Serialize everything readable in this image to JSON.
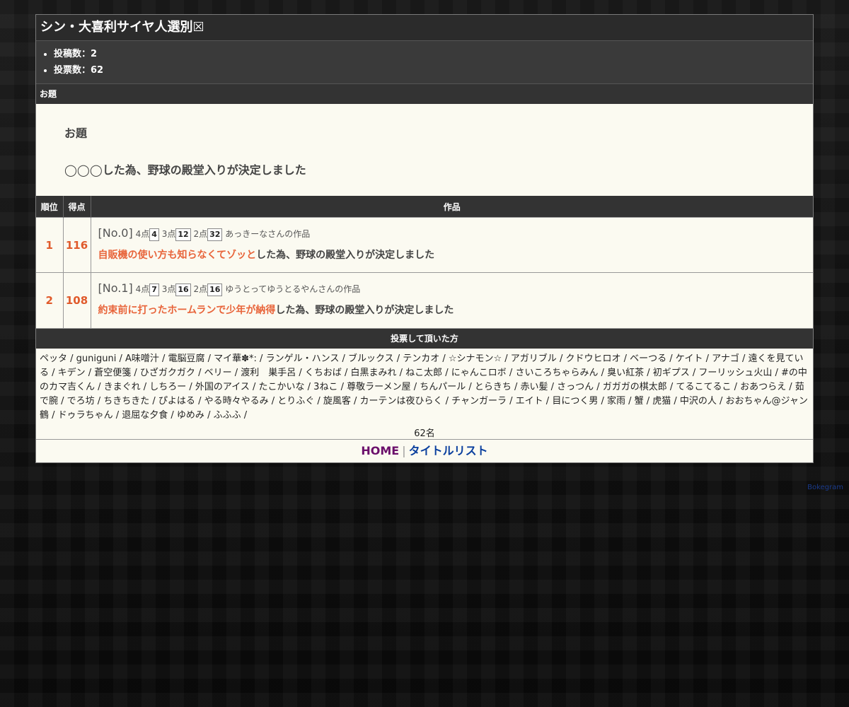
{
  "page": {
    "title": "シン・大喜利サイヤ人選別☒",
    "stats": [
      {
        "label": "投稿数：",
        "value": "2"
      },
      {
        "label": "投票数：",
        "value": "62"
      }
    ],
    "theme_section_head": "お題",
    "theme_label": "お題",
    "theme_text": "◯◯◯した為、野球の殿堂入りが決定しました"
  },
  "results": {
    "headers": {
      "rank": "順位",
      "score": "得点",
      "work": "作品"
    },
    "rows": [
      {
        "rank": "1",
        "score": "116",
        "no": "[No.0]",
        "p4_label": "4点",
        "p4": "4",
        "p3_label": "3点",
        "p3": "12",
        "p2_label": "2点",
        "p2": "32",
        "author": "あっきーなさんの作品",
        "highlight": "自販機の使い方も知らなくてゾッと",
        "suffix": "した為、野球の殿堂入りが決定しました"
      },
      {
        "rank": "2",
        "score": "108",
        "no": "[No.1]",
        "p4_label": "4点",
        "p4": "7",
        "p3_label": "3点",
        "p3": "16",
        "p2_label": "2点",
        "p2": "16",
        "author": "ゆうとってゆうとるやんさんの作品",
        "highlight": "約束前に打ったホームランで少年が納得",
        "suffix": "した為、野球の殿堂入りが決定しました"
      }
    ]
  },
  "voters": {
    "head": "投票して頂いた方",
    "list": "ペッタ / guniguni / A味噌汁 / 電脳豆腐 / マイ華✽*: / ランゲル・ハンス / ブルックス / テンカオ / ☆シナモン☆ / アガリブル / クドウヒロオ / ベーつる / ケイト / アナゴ / 遠くを見ている / キデン / 蒼空便箋 / ひざガクガク / ベリー / 渡利　巣手呂 / くちおば / 白黒まみれ / ねこ太郎 / にゃんこロボ / さいころちゃらみん / 臭い紅茶 / 初ギプス / フーリッシュ火山 / #の中のカマ吉くん / きまぐれ / しちろー / 外国のアイス / たこかいな / 3ねこ / 尊敬ラーメン屋 / ちんパール / とらきち / 赤い髪 / さっつん / ガガガの棋太郎 / てるこてるこ / おあつらえ / 茹で腕 / でろ坊 / ちきちきた / ぴよはる / やる時々やるみ / とりふぐ / 旋風客 / カーテンは夜ひらく / チャンガーラ / エイト / 目につく男 / 家雨 / 蟹 / 虎猫 / 中沢の人 / おおちゃん@ジャン鶴 / ドゥラちゃん / 退屈な夕食 / ゆめみ / ふふふ /",
    "count": "62名"
  },
  "nav": {
    "home": "HOME",
    "separator": "|",
    "title_list": "タイトルリスト"
  },
  "credit": "Bokegram",
  "colors": {
    "accent": "#e05a2b",
    "highlight": "#e8643a",
    "home_link": "#6b0f6b",
    "list_link": "#0a3f9e"
  }
}
